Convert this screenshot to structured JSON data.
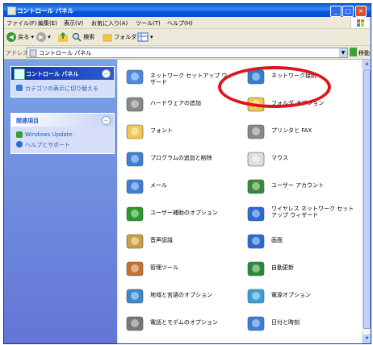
{
  "window": {
    "title": "コントロール パネル"
  },
  "menubar": [
    "ファイル(F)",
    "編集(E)",
    "表示(V)",
    "お気に入り(A)",
    "ツール(T)",
    "ヘルプ(H)"
  ],
  "toolbar": {
    "back": "戻る",
    "search": "検索",
    "folders": "フォルダ"
  },
  "address": {
    "label": "アドレス(D)",
    "value": "コントロール パネル",
    "go": "移動"
  },
  "leftpane": {
    "panel1": {
      "title": "コントロール パネル",
      "items": [
        "カテゴリの表示に切り替える"
      ]
    },
    "panel2": {
      "title": "関連項目",
      "items": [
        "Windows Update",
        "ヘルプとサポート"
      ]
    }
  },
  "items": [
    {
      "label": "ネットワーク セットアップ ウィザード",
      "icon": "network-setup-house-icon"
    },
    {
      "label": "ネットワーク接続",
      "icon": "network-connections-globe-icon"
    },
    {
      "label": "ハードウェアの追加",
      "icon": "add-hardware-icon"
    },
    {
      "label": "フォルダ オプション",
      "icon": "folder-options-icon"
    },
    {
      "label": "フォント",
      "icon": "fonts-folder-icon"
    },
    {
      "label": "プリンタと FAX",
      "icon": "printer-fax-icon"
    },
    {
      "label": "プログラムの追加と削除",
      "icon": "add-remove-programs-icon"
    },
    {
      "label": "マウス",
      "icon": "mouse-icon"
    },
    {
      "label": "メール",
      "icon": "mail-icon"
    },
    {
      "label": "ユーザー アカウント",
      "icon": "user-accounts-icon"
    },
    {
      "label": "ユーザー補助のオプション",
      "icon": "accessibility-icon"
    },
    {
      "label": "ワイヤレス ネットワーク セットアップ ウィザード",
      "icon": "wireless-network-icon"
    },
    {
      "label": "音声認識",
      "icon": "speech-icon"
    },
    {
      "label": "画面",
      "icon": "display-icon"
    },
    {
      "label": "管理ツール",
      "icon": "admin-tools-icon"
    },
    {
      "label": "自動更新",
      "icon": "automatic-updates-icon"
    },
    {
      "label": "地域と言語のオプション",
      "icon": "regional-language-globe-icon"
    },
    {
      "label": "電源オプション",
      "icon": "power-options-icon"
    },
    {
      "label": "電話とモデムのオプション",
      "icon": "phone-modem-icon"
    },
    {
      "label": "日付と時刻",
      "icon": "date-time-clock-icon"
    }
  ],
  "colors": {
    "titlebar": "#0a5fd6",
    "leftpane": "#6d8ee0",
    "highlight": "#e0141e"
  }
}
